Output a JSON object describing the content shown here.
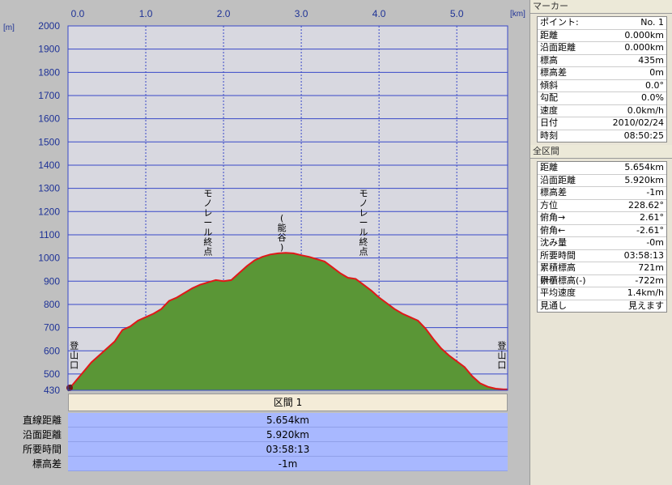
{
  "colors": {
    "plot_bg": "#d8d8e0",
    "grid": "#3848c8",
    "fill": "#5a9636",
    "line": "#e01818",
    "axis_text": "#1e3296",
    "stats_bg": "#a8b8ff"
  },
  "chart_data": {
    "type": "area",
    "xunit": "[km]",
    "yunit": "[m]",
    "xlim": [
      0,
      5.654
    ],
    "ylim": [
      430,
      2000
    ],
    "xticks": [
      "0.0",
      "1.0",
      "2.0",
      "3.0",
      "4.0",
      "5.0"
    ],
    "xtick_values": [
      0,
      1,
      2,
      3,
      4,
      5
    ],
    "yticks": [
      "2000",
      "1900",
      "1800",
      "1700",
      "1600",
      "1500",
      "1400",
      "1300",
      "1200",
      "1100",
      "1000",
      "900",
      "800",
      "700",
      "600",
      "500",
      "430"
    ],
    "ytick_values": [
      2000,
      1900,
      1800,
      1700,
      1600,
      1500,
      1400,
      1300,
      1200,
      1100,
      1000,
      900,
      800,
      700,
      600,
      500,
      430
    ],
    "grid": true,
    "x": [
      0,
      0.05,
      0.1,
      0.2,
      0.3,
      0.4,
      0.5,
      0.6,
      0.65,
      0.7,
      0.8,
      0.9,
      1.0,
      1.1,
      1.2,
      1.3,
      1.4,
      1.5,
      1.6,
      1.7,
      1.8,
      1.9,
      2.0,
      2.1,
      2.2,
      2.3,
      2.4,
      2.5,
      2.6,
      2.7,
      2.8,
      2.9,
      3.0,
      3.1,
      3.2,
      3.3,
      3.4,
      3.5,
      3.6,
      3.7,
      3.8,
      3.9,
      4.0,
      4.1,
      4.2,
      4.3,
      4.4,
      4.5,
      4.6,
      4.7,
      4.8,
      4.9,
      5.0,
      5.1,
      5.2,
      5.3,
      5.4,
      5.5,
      5.6,
      5.654
    ],
    "y": [
      435,
      450,
      470,
      510,
      550,
      580,
      610,
      640,
      665,
      690,
      705,
      730,
      745,
      760,
      780,
      815,
      830,
      850,
      870,
      885,
      895,
      905,
      900,
      905,
      935,
      965,
      990,
      1005,
      1015,
      1020,
      1022,
      1020,
      1012,
      1005,
      995,
      985,
      960,
      935,
      915,
      910,
      885,
      860,
      830,
      805,
      780,
      760,
      745,
      730,
      695,
      650,
      610,
      580,
      555,
      530,
      490,
      460,
      445,
      437,
      434,
      434
    ],
    "annotations": [
      {
        "text": "登山口",
        "x": 0.08,
        "y": 610
      },
      {
        "text": "モノレール終点",
        "x": 1.8,
        "y": 1265
      },
      {
        "text": "(能谷)",
        "x": 2.75,
        "y": 1160
      },
      {
        "text": "モノレール終点",
        "x": 3.8,
        "y": 1265
      },
      {
        "text": "登山口",
        "x": 5.58,
        "y": 610
      }
    ]
  },
  "section": {
    "header": "区間 1"
  },
  "stats": [
    {
      "label": "直線距離",
      "value": "5.654km"
    },
    {
      "label": "沿面距離",
      "value": "5.920km"
    },
    {
      "label": "所要時間",
      "value": "03:58:13"
    },
    {
      "label": "標高差",
      "value": "-1m"
    }
  ],
  "marker": {
    "title": "マーカー",
    "rows": [
      {
        "k": "ポイント:",
        "v": "No. 1"
      },
      {
        "k": "距離",
        "v": "0.000km"
      },
      {
        "k": "沿面距離",
        "v": "0.000km"
      },
      {
        "k": "標高",
        "v": "435m"
      },
      {
        "k": "標高差",
        "v": "0m"
      },
      {
        "k": "傾斜",
        "v": "0.0°"
      },
      {
        "k": "勾配",
        "v": "0.0%"
      },
      {
        "k": "速度",
        "v": "0.0km/h"
      },
      {
        "k": "日付",
        "v": "2010/02/24"
      },
      {
        "k": "時刻",
        "v": "08:50:25"
      }
    ]
  },
  "full": {
    "title": "全区間",
    "rows": [
      {
        "k": "距離",
        "v": "5.654km"
      },
      {
        "k": "沿面距離",
        "v": "5.920km"
      },
      {
        "k": "標高差",
        "v": "-1m"
      },
      {
        "k": "方位",
        "v": "228.62°"
      },
      {
        "k": "俯角→",
        "v": "2.61°"
      },
      {
        "k": "俯角←",
        "v": "-2.61°"
      },
      {
        "k": "沈み量",
        "v": "-0m"
      },
      {
        "k": "所要時間",
        "v": "03:58:13"
      },
      {
        "k": "累積標高(+)",
        "v": "721m"
      },
      {
        "k": "累積標高(-)",
        "v": "-722m"
      },
      {
        "k": "平均速度",
        "v": "1.4km/h"
      },
      {
        "k": "見通し",
        "v": "見えます"
      }
    ]
  }
}
